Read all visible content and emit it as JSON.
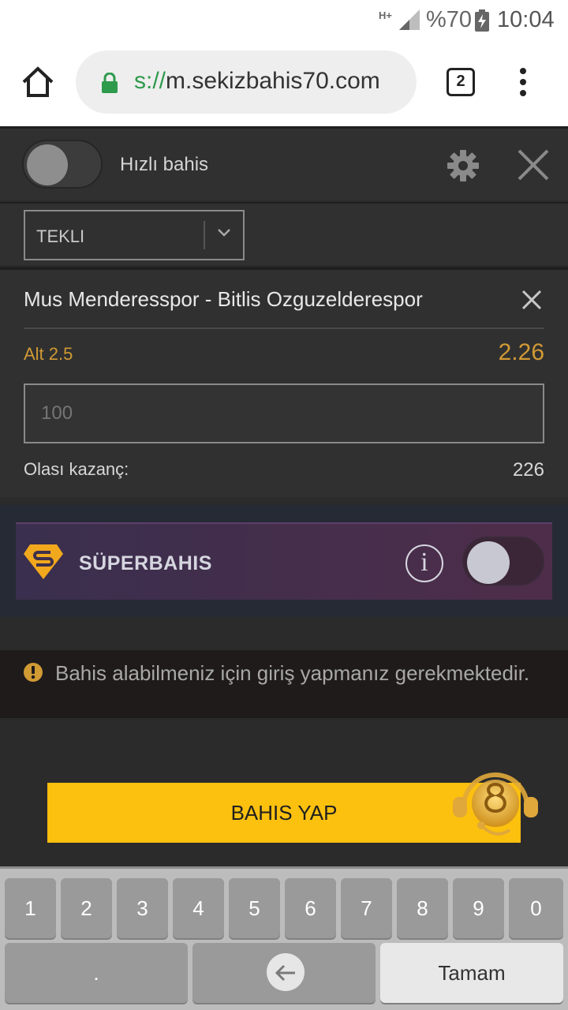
{
  "status_bar": {
    "network": "H+",
    "battery": "%70",
    "time": "10:04"
  },
  "browser": {
    "url_scheme": "s://",
    "url_host": "m.sekizbahis70.com",
    "tab_count": "2"
  },
  "bet_slip": {
    "quick_bet_label": "Hızlı bahis",
    "bet_type": "TEKLI",
    "match": "Mus Menderesspor - Bitlis Ozguzelderespor",
    "market": "Alt 2.5",
    "odds": "2.26",
    "stake_placeholder": "100",
    "potential_win_label": "Olası kazanç:",
    "potential_win": "226"
  },
  "superbahis": {
    "label": "SÜPERBAHIS",
    "info_glyph": "i"
  },
  "warning": {
    "text": "Bahis alabilmeniz için giriş yapmanız gerekmektedir."
  },
  "place_bet": {
    "label": "BAHIS YAP"
  },
  "keyboard": {
    "digits": [
      "1",
      "2",
      "3",
      "4",
      "5",
      "6",
      "7",
      "8",
      "9",
      "0"
    ],
    "dot": ".",
    "done": "Tamam"
  },
  "colors": {
    "accent_gold": "#d09a34",
    "button_yellow": "#fcc00f",
    "panel_dark": "#303030"
  }
}
